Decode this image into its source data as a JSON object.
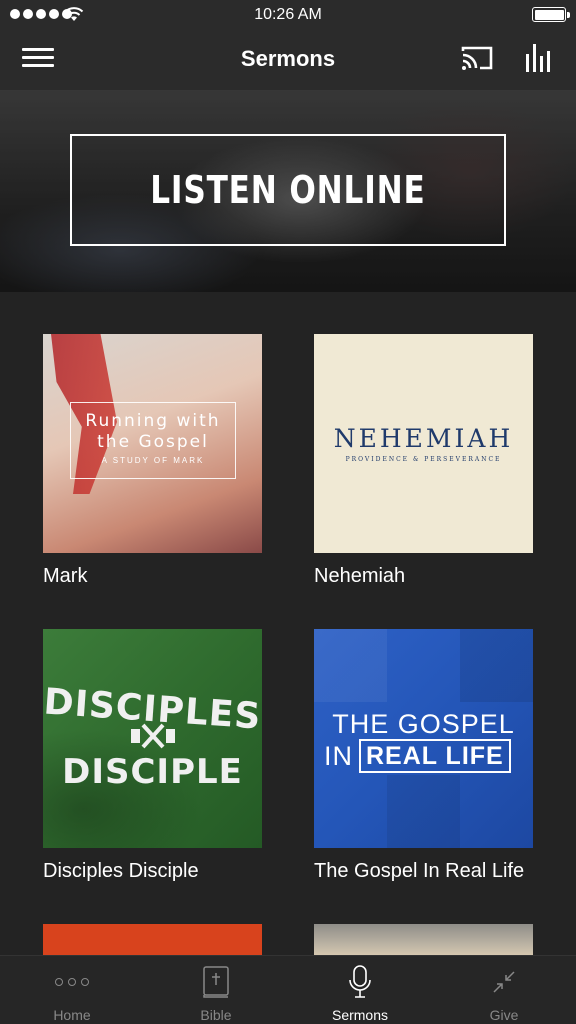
{
  "status_bar": {
    "time": "10:26 AM"
  },
  "nav": {
    "title": "Sermons",
    "icons": [
      "menu-icon",
      "cast-icon",
      "stats-icon"
    ]
  },
  "hero": {
    "text": "LISTEN ONLINE"
  },
  "series": [
    {
      "label": "Mark",
      "art_title_line1": "Running with",
      "art_title_line2": "the Gospel",
      "art_subtitle": "A STUDY OF MARK"
    },
    {
      "label": "Nehemiah",
      "art_title": "NEHEMIAH",
      "art_subtitle": "PROVIDENCE & PERSEVERANCE"
    },
    {
      "label": "Disciples Disciple",
      "art_top": "DISCIPLES",
      "art_bottom": "DISCIPLE"
    },
    {
      "label": "The Gospel In Real Life",
      "art_line1": "THE GOSPEL",
      "art_in": "IN",
      "art_box": "REAL LIFE"
    }
  ],
  "colors": {
    "background": "#232323",
    "bar": "#2b2b2b",
    "mark_accent": "#c93a33",
    "nehemiah_blue": "#1f3a6b",
    "disciples_green": "#2f6b2e",
    "gospel_blue": "#2456b8",
    "orange_tile": "#d8431d"
  },
  "tabs": [
    {
      "label": "Home",
      "icon": "more-dots-icon",
      "active": false
    },
    {
      "label": "Bible",
      "icon": "bible-icon",
      "active": false
    },
    {
      "label": "Sermons",
      "icon": "microphone-icon",
      "active": true
    },
    {
      "label": "Give",
      "icon": "give-icon",
      "active": false
    }
  ]
}
